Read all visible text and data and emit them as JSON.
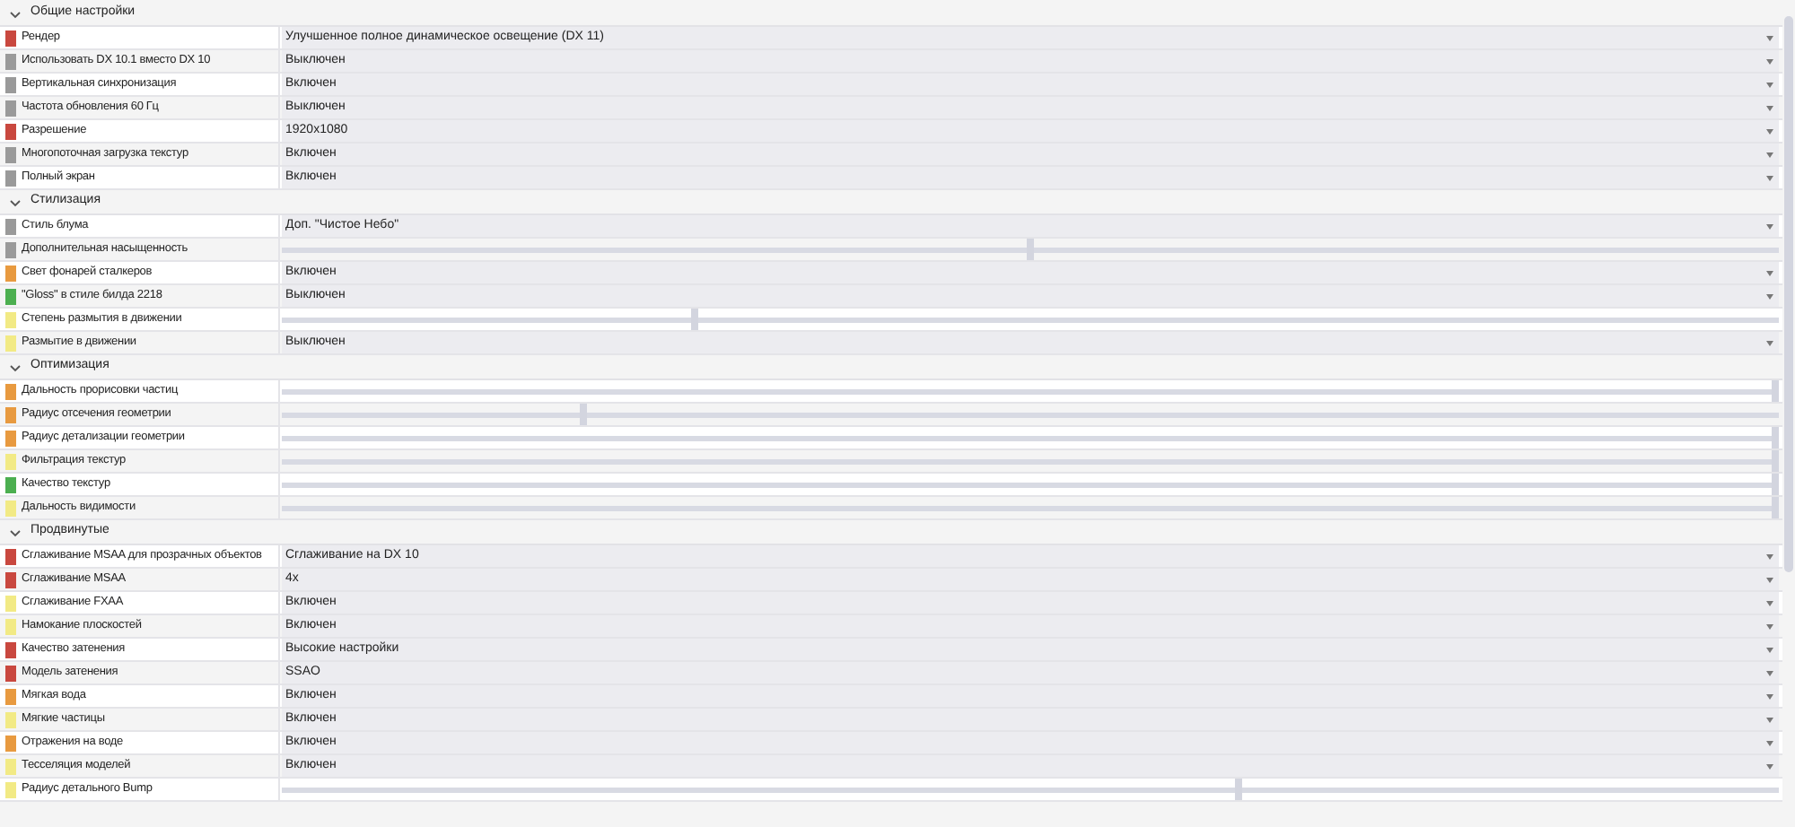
{
  "sections": [
    {
      "title": "Общие настройки",
      "expanded": true,
      "rows": [
        {
          "label": "Рендер",
          "color": "#c9483f",
          "kind": "dropdown",
          "value": "Улучшенное полное динамическое освещение (DX 11)"
        },
        {
          "label": "Использовать DX 10.1 вместо DX 10",
          "color": "#9a9a9a",
          "kind": "dropdown",
          "value": "Выключен"
        },
        {
          "label": "Вертикальная синхронизация",
          "color": "#9a9a9a",
          "kind": "dropdown",
          "value": "Включен"
        },
        {
          "label": "Частота обновления 60 Гц",
          "color": "#9a9a9a",
          "kind": "dropdown",
          "value": "Выключен"
        },
        {
          "label": "Разрешение",
          "color": "#c9483f",
          "kind": "dropdown",
          "value": "1920x1080"
        },
        {
          "label": "Многопоточная загрузка текстур",
          "color": "#9a9a9a",
          "kind": "dropdown",
          "value": "Включен"
        },
        {
          "label": "Полный экран",
          "color": "#9a9a9a",
          "kind": "dropdown",
          "value": "Включен"
        }
      ]
    },
    {
      "title": "Стилизация",
      "expanded": true,
      "rows": [
        {
          "label": "Стиль блума",
          "color": "#9a9a9a",
          "kind": "dropdown",
          "value": "Доп. \"Чистое Небо\""
        },
        {
          "label": "Дополнительная насыщенность",
          "color": "#9a9a9a",
          "kind": "slider",
          "level": 0.5
        },
        {
          "label": "Свет фонарей сталкеров",
          "color": "#e89a40",
          "kind": "dropdown",
          "value": "Включен"
        },
        {
          "label": "\"Gloss\" в стиле билда 2218",
          "color": "#4caf50",
          "kind": "dropdown",
          "value": "Выключен"
        },
        {
          "label": "Степень размытия в движении",
          "color": "#f2ea85",
          "kind": "slider",
          "level": 0.275
        },
        {
          "label": "Размытие в движении",
          "color": "#f2ea85",
          "kind": "dropdown",
          "value": "Выключен"
        }
      ]
    },
    {
      "title": "Оптимизация",
      "expanded": true,
      "rows": [
        {
          "label": "Дальность прорисовки частиц",
          "color": "#e89a40",
          "kind": "slider",
          "level": 1
        },
        {
          "label": "Радиус отсечения геометрии",
          "color": "#e89a40",
          "kind": "slider",
          "level": 0.2
        },
        {
          "label": "Радиус детализации геометрии",
          "color": "#e89a40",
          "kind": "slider",
          "level": 1
        },
        {
          "label": "Фильтрация текстур",
          "color": "#f2ea85",
          "kind": "slider",
          "level": 1
        },
        {
          "label": "Качество текстур",
          "color": "#4caf50",
          "kind": "slider",
          "level": 1
        },
        {
          "label": "Дальность видимости",
          "color": "#f2ea85",
          "kind": "slider",
          "level": 1
        }
      ]
    },
    {
      "title": "Продвинутые",
      "expanded": true,
      "rows": [
        {
          "label": "Сглаживание MSAA для прозрачных объектов",
          "color": "#c9483f",
          "kind": "dropdown",
          "value": "Сглаживание на DX 10"
        },
        {
          "label": "Сглаживание MSAA",
          "color": "#c9483f",
          "kind": "dropdown",
          "value": "4x"
        },
        {
          "label": "Сглаживание FXAA",
          "color": "#f2ea85",
          "kind": "dropdown",
          "value": "Включен"
        },
        {
          "label": "Намокание плоскостей",
          "color": "#f2ea85",
          "kind": "dropdown",
          "value": "Включен"
        },
        {
          "label": "Качество затенения",
          "color": "#c9483f",
          "kind": "dropdown",
          "value": "Высокие настройки"
        },
        {
          "label": "Модель затенения",
          "color": "#c9483f",
          "kind": "dropdown",
          "value": "SSAO"
        },
        {
          "label": "Мягкая вода",
          "color": "#e89a40",
          "kind": "dropdown",
          "value": "Включен"
        },
        {
          "label": "Мягкие частицы",
          "color": "#f2ea85",
          "kind": "dropdown",
          "value": "Включен"
        },
        {
          "label": "Отражения на воде",
          "color": "#e89a40",
          "kind": "dropdown",
          "value": "Включен"
        },
        {
          "label": "Тесселяция моделей",
          "color": "#f2ea85",
          "kind": "dropdown",
          "value": "Включен"
        },
        {
          "label": "Радиус детального Bump",
          "color": "#f2ea85",
          "kind": "slider",
          "level": 0.64
        }
      ]
    }
  ]
}
